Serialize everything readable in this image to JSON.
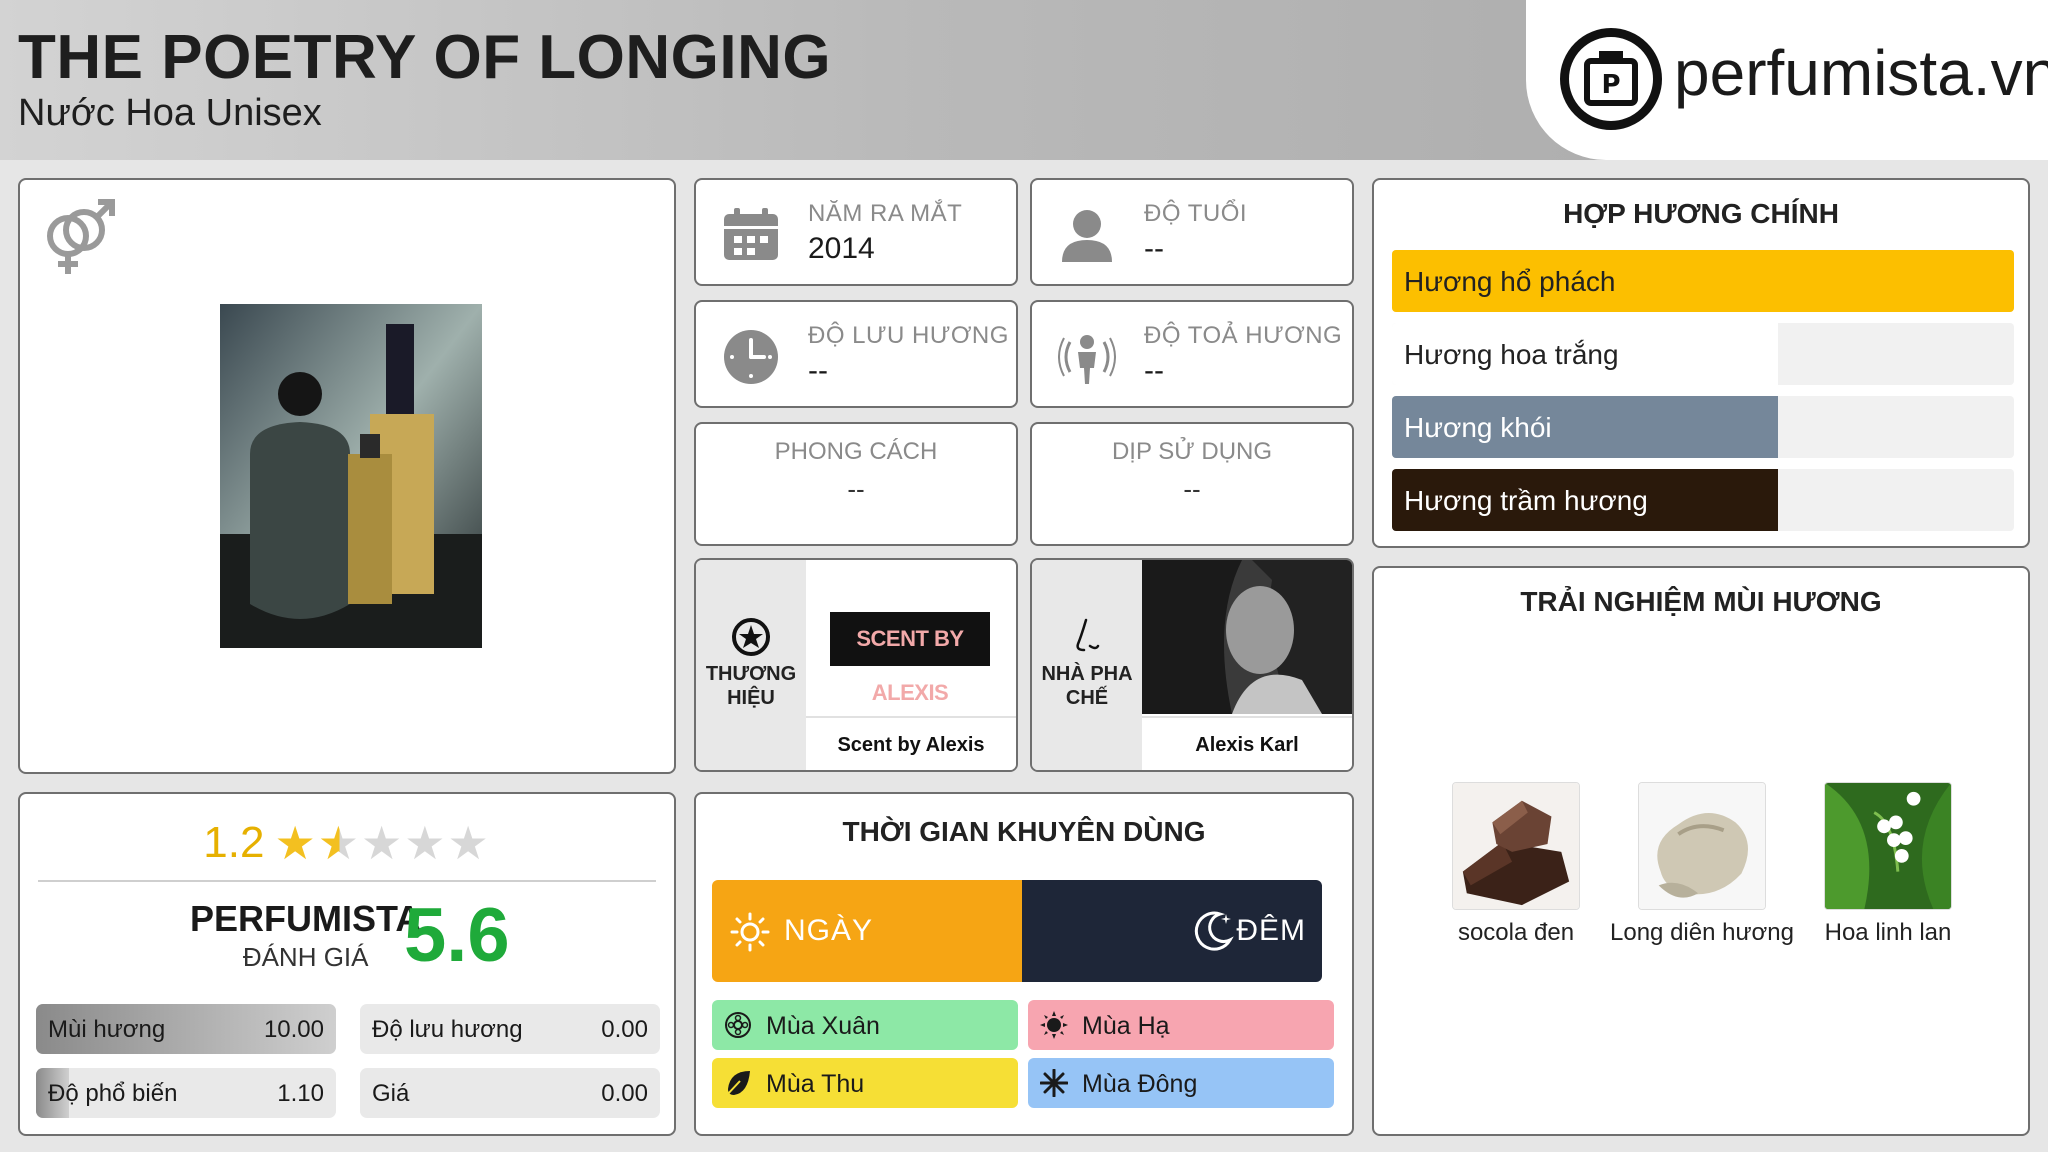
{
  "header": {
    "title": "THE POETRY OF LONGING",
    "subtitle": "Nước Hoa Unisex",
    "logo_text": "perfumista.vn"
  },
  "rating": {
    "score": "1.2",
    "stars_value": 1.2,
    "stars_max": 5,
    "perfumista_label": "PERFUMISTA",
    "perfumista_sub": "ĐÁNH GIÁ",
    "perfumista_score": "5.6",
    "metrics": [
      {
        "label": "Mùi hương",
        "value": "10.00",
        "fraction": 1.0
      },
      {
        "label": "Độ lưu hương",
        "value": "0.00",
        "fraction": 0.0
      },
      {
        "label": "Độ phổ biến",
        "value": "1.10",
        "fraction": 0.11
      },
      {
        "label": "Giá",
        "value": "0.00",
        "fraction": 0.0
      }
    ]
  },
  "info": {
    "launch_year": {
      "label": "NĂM RA MẮT",
      "value": "2014",
      "icon": "calendar-icon"
    },
    "age": {
      "label": "ĐỘ TUỔI",
      "value": "--",
      "icon": "person-icon"
    },
    "longevity": {
      "label": "ĐỘ LƯU HƯƠNG",
      "value": "--",
      "icon": "clock-icon"
    },
    "sillage": {
      "label": "ĐỘ TOẢ HƯƠNG",
      "value": "--",
      "icon": "sillage-icon"
    },
    "style": {
      "label": "PHONG CÁCH",
      "value": "--"
    },
    "occasion": {
      "label": "DỊP SỬ DỤNG",
      "value": "--"
    }
  },
  "brand": {
    "side_label": "THƯƠNG HIỆU",
    "logo_text": "SCENT BY ALEXIS",
    "name": "Scent by Alexis",
    "icon": "star-circle-icon"
  },
  "perfumer": {
    "side_label": "NHÀ PHA CHẾ",
    "name": "Alexis Karl",
    "icon": "nose-icon"
  },
  "time": {
    "title": "THỜI GIAN KHUYÊN DÙNG",
    "day_label": "NGÀY",
    "night_label": "ĐÊM",
    "seasons": [
      {
        "label": "Mùa Xuân",
        "color": "#8de8a6",
        "icon": "flower-icon"
      },
      {
        "label": "Mùa Hạ",
        "color": "#f7a5b0",
        "icon": "sun-icon"
      },
      {
        "label": "Mùa Thu",
        "color": "#f6df35",
        "icon": "leaf-icon"
      },
      {
        "label": "Mùa Đông",
        "color": "#96c4f6",
        "icon": "snowflake-icon"
      }
    ]
  },
  "accords": {
    "title": "HỢP HƯƠNG CHÍNH",
    "items": [
      {
        "label": "Hương hổ phách",
        "fraction": 1.0,
        "color": "#fcbf00",
        "text_color": "#222222"
      },
      {
        "label": "Hương hoa trắng",
        "fraction": 0.62,
        "color": "#ffffff",
        "text_color": "#222222"
      },
      {
        "label": "Hương khói",
        "fraction": 0.62,
        "color": "#75879a",
        "text_color": "#ffffff"
      },
      {
        "label": "Hương trầm hương",
        "fraction": 0.62,
        "color": "#2a190b",
        "text_color": "#ffffff"
      }
    ]
  },
  "notes": {
    "title": "TRẢI NGHIỆM MÙI HƯƠNG",
    "items": [
      {
        "label": "socola đen"
      },
      {
        "label": "Long diên hương"
      },
      {
        "label": "Hoa linh lan"
      }
    ]
  }
}
